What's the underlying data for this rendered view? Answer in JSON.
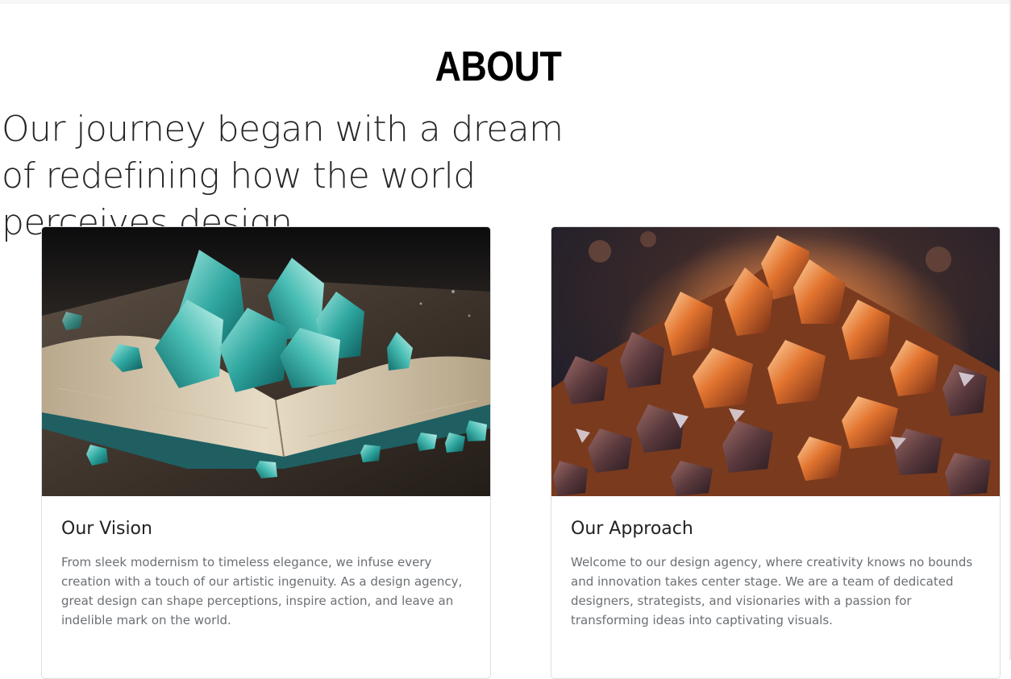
{
  "page": {
    "title": "ABOUT",
    "lead": "Our journey began with a dream of redefining how the world perceives design."
  },
  "cards": [
    {
      "image": "teal-crystals-on-open-book-image",
      "title": "Our Vision",
      "text": "From sleek modernism to timeless elegance, we infuse every creation with a touch of our artistic ingenuity. As a design agency, great design can shape perceptions, inspire action, and leave an indelible mark on the world."
    },
    {
      "image": "orange-crystal-cluster-image",
      "title": "Our Approach",
      "text": "Welcome to our design agency, where creativity knows no bounds and innovation takes center stage. We are a team of dedicated designers, strategists, and visionaries with a passion for transforming ideas into captivating visuals."
    }
  ],
  "colors": {
    "title": "#000000",
    "lead": "#262626",
    "card_title": "#222222",
    "card_text": "#6b6f74",
    "card_border": "#dedede",
    "teal": "#3fb6ad",
    "amber": "#e9813a"
  }
}
